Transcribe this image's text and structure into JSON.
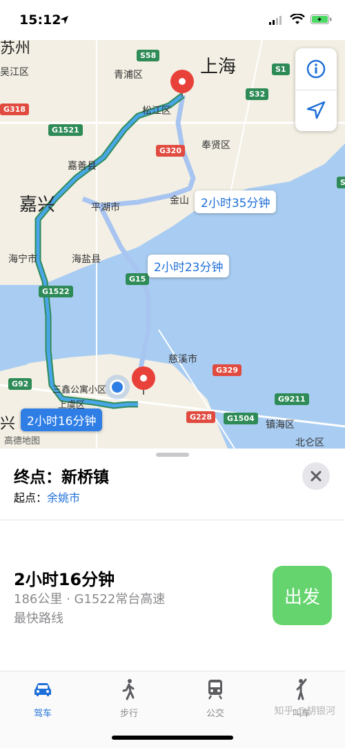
{
  "status_bar": {
    "time": "15:12"
  },
  "map": {
    "cities": [
      {
        "id": "shanghai",
        "label": "上海"
      },
      {
        "id": "jiaxing",
        "label": "嘉兴"
      }
    ],
    "places": [
      {
        "id": "qingpu",
        "label": "青浦区"
      },
      {
        "id": "songjiang",
        "label": "松江区"
      },
      {
        "id": "jiashan",
        "label": "嘉善县"
      },
      {
        "id": "fengxian",
        "label": "奉贤区"
      },
      {
        "id": "pinghu",
        "label": "平湖市"
      },
      {
        "id": "jinshan",
        "label": "金山"
      },
      {
        "id": "haining",
        "label": "海宁市"
      },
      {
        "id": "haiyan",
        "label": "海盐县"
      },
      {
        "id": "cixi",
        "label": "慈溪市"
      },
      {
        "id": "sanxin",
        "label": "三鑫公寓小区"
      },
      {
        "id": "shangyu",
        "label": "上虞区"
      },
      {
        "id": "zhenhai",
        "label": "镇海区"
      },
      {
        "id": "beilun",
        "label": "北仑区"
      },
      {
        "id": "wujiang",
        "label": "吴江区"
      },
      {
        "id": "suzhou_part",
        "label": "苏州"
      },
      {
        "id": "xing_part",
        "label": "兴"
      },
      {
        "id": "gaode",
        "label": "高德地图"
      }
    ],
    "shields": [
      {
        "id": "s58",
        "label": "S58",
        "color": "green"
      },
      {
        "id": "s1",
        "label": "S1",
        "color": "green"
      },
      {
        "id": "s32",
        "label": "S32",
        "color": "green"
      },
      {
        "id": "g318",
        "label": "G318",
        "color": "red"
      },
      {
        "id": "g1521",
        "label": "G1521",
        "color": "green"
      },
      {
        "id": "g320",
        "label": "G320",
        "color": "red"
      },
      {
        "id": "g15",
        "label": "G15",
        "color": "green"
      },
      {
        "id": "g1522",
        "label": "G1522",
        "color": "green"
      },
      {
        "id": "g92",
        "label": "G92",
        "color": "green"
      },
      {
        "id": "g329",
        "label": "G329",
        "color": "red"
      },
      {
        "id": "g9211",
        "label": "G9211",
        "color": "green"
      },
      {
        "id": "g228",
        "label": "G228",
        "color": "red"
      },
      {
        "id": "g1504",
        "label": "G1504",
        "color": "green"
      },
      {
        "id": "s_edge",
        "label": "S",
        "color": "green"
      }
    ],
    "route_labels": {
      "route1": "2小时35分钟",
      "route2": "2小时23分钟",
      "route_selected": "2小时16分钟"
    },
    "colors": {
      "water": "#a9cdf2",
      "land": "#f3efe4",
      "route_selected": "#4aa6e8",
      "route_alt": "#a8c4f0",
      "pin": "#e8413a"
    }
  },
  "map_buttons": {
    "info_icon": "info-icon",
    "location_icon": "location-arrow-icon"
  },
  "panel": {
    "destination_prefix": "终点：",
    "destination": "新桥镇",
    "origin_prefix": "起点：",
    "origin": "余姚市",
    "route": {
      "time": "2小时16分钟",
      "detail": "186公里 · G1522常台高速",
      "note": "最快路线"
    },
    "go_label": "出发"
  },
  "tabs": [
    {
      "id": "drive",
      "label": "驾车",
      "icon": "car-icon",
      "active": true
    },
    {
      "id": "walk",
      "label": "步行",
      "icon": "walking-icon",
      "active": false
    },
    {
      "id": "transit",
      "label": "公交",
      "icon": "train-icon",
      "active": false
    },
    {
      "id": "ride",
      "label": "叫车",
      "icon": "hailing-icon",
      "active": false
    }
  ],
  "watermark": "知乎 @胡银河"
}
